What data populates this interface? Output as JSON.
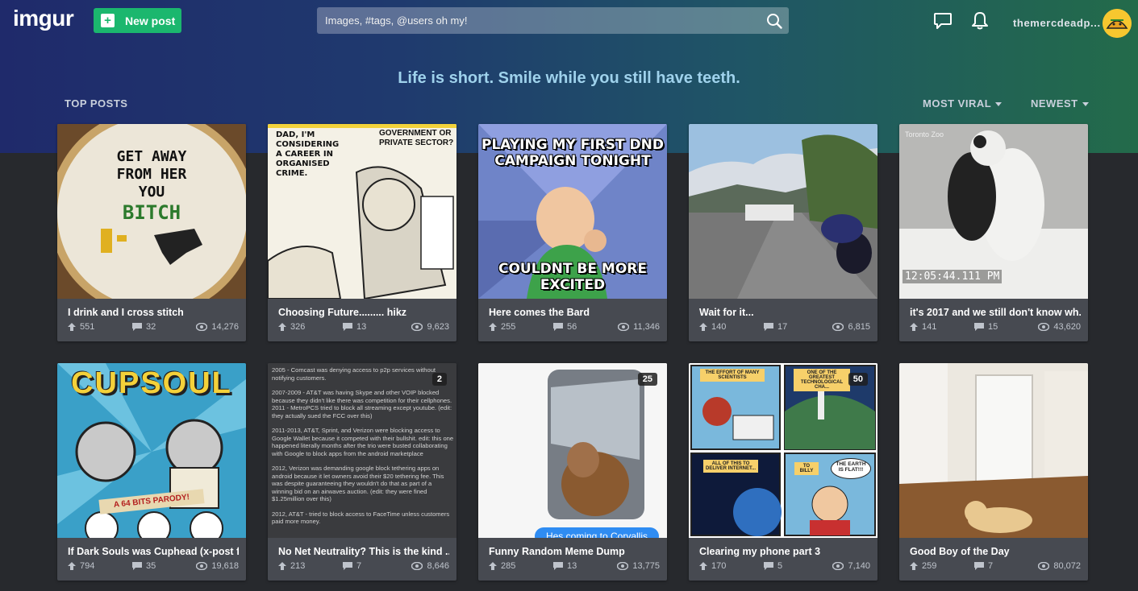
{
  "header": {
    "logo": "imgur",
    "new_post_label": "New post",
    "search_placeholder": "Images, #tags, @users oh my!",
    "username": "themercdeadp..."
  },
  "hero": {
    "tagline": "Life is short. Smile while you still have teeth.",
    "section_label": "TOP POSTS",
    "sort_primary": "MOST VIRAL",
    "sort_secondary": "NEWEST"
  },
  "posts": [
    {
      "title": "I drink and I cross stitch",
      "upvotes": "551",
      "comments": "32",
      "views": "14,276",
      "image_text": [
        "GET AWAY",
        "FROM HER",
        "YOU",
        "BITCH"
      ]
    },
    {
      "title": "Choosing Future......... hikz",
      "upvotes": "326",
      "comments": "13",
      "views": "9,623",
      "image_text": [
        "DAD, I'M CONSIDERING A CAREER IN ORGANISED CRIME.",
        "GOVERNMENT OR PRIVATE SECTOR?"
      ]
    },
    {
      "title": "Here comes the Bard",
      "upvotes": "255",
      "comments": "56",
      "views": "11,346",
      "image_text": [
        "PLAYING MY FIRST DND CAMPAIGN TONIGHT",
        "COULDNT BE MORE EXCITED"
      ]
    },
    {
      "title": "Wait for it...",
      "upvotes": "140",
      "comments": "17",
      "views": "6,815"
    },
    {
      "title": "it's 2017 and we still don't know wh...",
      "upvotes": "141",
      "comments": "15",
      "views": "43,620",
      "image_text": [
        "Toronto Zoo",
        "12:05:44.111 PM"
      ]
    },
    {
      "title": "If Dark Souls was Cuphead (x-post f...",
      "upvotes": "794",
      "comments": "35",
      "views": "19,618",
      "image_text": [
        "CUPSOUL",
        "A 64 BITS PARODY!"
      ]
    },
    {
      "title": "No Net Neutrality?  This is the kind ...",
      "upvotes": "213",
      "comments": "7",
      "views": "8,646",
      "count": "2",
      "image_text": [
        "2005 - Comcast was denying access to p2p services without notifying customers.",
        "2007-2009 - AT&T was having Skype and other VOIP blocked because they didn't like there was competition for their cellphones.",
        "2011 - MetroPCS tried to block all streaming except youtube. (edit: they actually sued the FCC over this)",
        "2011-2013, AT&T, Sprint, and Verizon were blocking access to Google Wallet because it competed with their bullshit. edit: this one happened literally months after the trio were busted collaborating with Google to block apps from the android marketplace",
        "2012, Verizon was demanding google block tethering apps on android because it let owners avoid their $20 tethering fee. This was despite guaranteeing they wouldn't do that as part of a winning bid on an airwaves auction. (edit: they were fined $1.25million over this)",
        "2012, AT&T - tried to block access to FaceTime unless customers paid more money."
      ]
    },
    {
      "title": "Funny Random Meme Dump",
      "upvotes": "285",
      "comments": "13",
      "views": "13,775",
      "count": "25",
      "image_text": [
        "Hes coming to Corvallis"
      ]
    },
    {
      "title": "Clearing my phone part 3",
      "upvotes": "170",
      "comments": "5",
      "views": "7,140",
      "count": "50",
      "image_text": [
        "THE EFFORT OF MANY SCIENTISTS",
        "ONE OF THE GREATEST TECHNOLOGICAL CHA...",
        "ALL OF THIS TO DELIVER INTERNET...",
        "TO BILLY",
        "THE EARTH IS FLAT!!!"
      ]
    },
    {
      "title": "Good Boy of the Day",
      "upvotes": "259",
      "comments": "7",
      "views": "80,072"
    }
  ],
  "colors": {
    "accent_green": "#1bb76e",
    "tagline": "#9fd2ec",
    "card_bg": "#474a51",
    "page_bg": "#27292d"
  }
}
